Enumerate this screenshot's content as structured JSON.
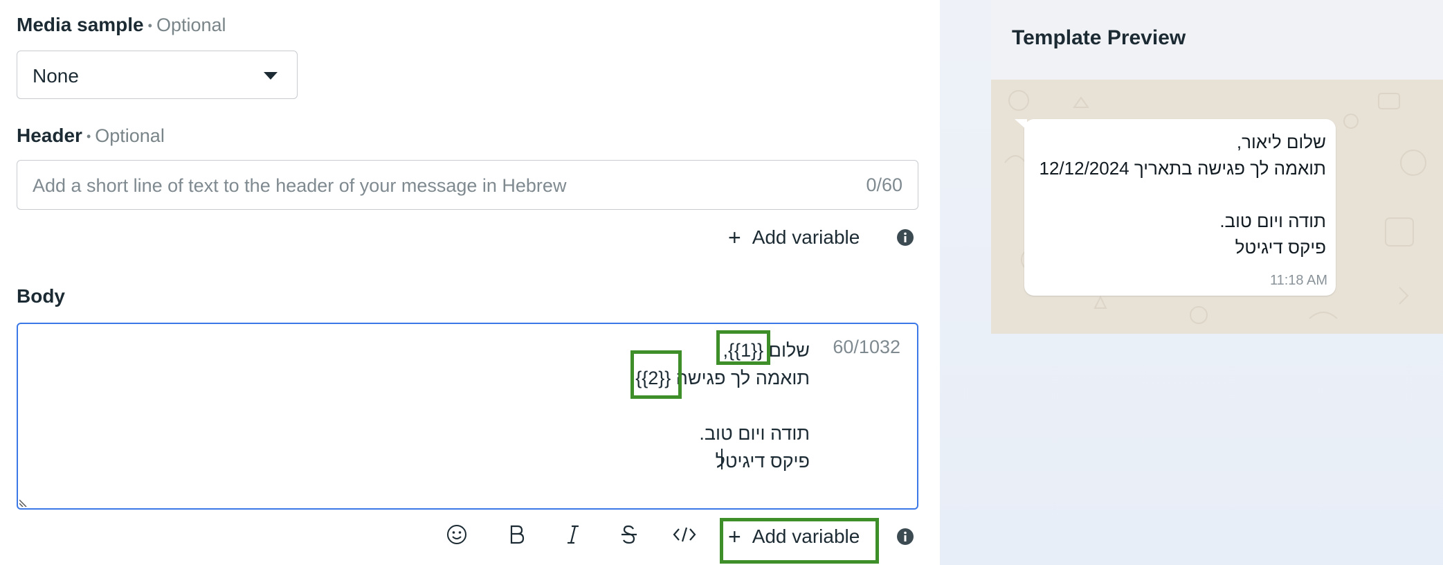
{
  "media_sample": {
    "label": "Media sample",
    "optional": "Optional",
    "selected": "None"
  },
  "header": {
    "label": "Header",
    "optional": "Optional",
    "placeholder": "Add a short line of text to the header of your message in Hebrew",
    "counter": "0/60",
    "add_variable": "Add variable"
  },
  "body": {
    "label": "Body",
    "counter": "60/1032",
    "text": "שלום {{1}},\nתואמה לך פגישה {{2}}\n\nתודה ויום טוב.\nפיקס דיגיטל",
    "add_variable": "Add variable"
  },
  "toolbar": {
    "emoji_icon": "emoji-icon",
    "bold_icon": "bold-icon",
    "italic_icon": "italic-icon",
    "strike_icon": "strikethrough-icon",
    "code_icon": "code-icon"
  },
  "preview": {
    "title": "Template Preview",
    "message": "שלום ליאור,\nתואמה לך פגישה בתאריך 12/12/2024\n\nתודה ויום טוב.\nפיקס דיגיטל",
    "time": "11:18 AM"
  },
  "colors": {
    "accent_border": "#3b78e7",
    "highlight": "#3e8e2a",
    "chat_background": "#e7e1d6"
  }
}
